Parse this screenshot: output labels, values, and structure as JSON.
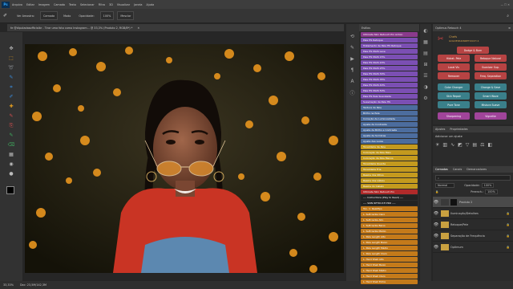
{
  "menubar": {
    "logo": "Ps",
    "items": [
      "Arquivo",
      "Editar",
      "Imagem",
      "Camada",
      "Texto",
      "Selecionar",
      "Filtro",
      "3D",
      "Visualizar",
      "Janela",
      "Ajuda"
    ]
  },
  "options_bar": {
    "items": [
      "Ver Amostra:",
      "Camada",
      "Modo",
      "Opacidade:",
      "100%",
      "Mesclar"
    ]
  },
  "document": {
    "tab_title": "fe @diputadasofficialbr - Tirar uma foto como Instagram... @ 33,3% (Produto 2, RGB/8*) *",
    "zoom": "33,33%",
    "status_info": "Doc: 23,5M/142,3M"
  },
  "toolbar": {
    "tools": [
      "move-tool",
      "marquee-tool",
      "lasso-tool",
      "quick-select-tool",
      "crop-tool",
      "eyedropper-tool",
      "spot-heal-tool",
      "brush-tool",
      "clone-stamp-tool",
      "history-brush-tool",
      "eraser-tool",
      "gradient-tool",
      "blur-tool",
      "dodge-tool",
      "pen-tool",
      "type-tool",
      "path-select-tool",
      "shape-tool",
      "hand-tool",
      "zoom-tool"
    ],
    "glyphs": [
      "✥",
      "⬚",
      "➰",
      "✎",
      "⌗",
      "✐",
      "✚",
      "✎",
      "⎘",
      "✎",
      "⌫",
      "▦",
      "◉",
      "●",
      "✒",
      "T",
      "↖",
      "▭",
      "✋",
      "🔍"
    ]
  },
  "styles_panel": {
    "title": "Estilos",
    "items": [
      {
        "label": "Ultimate Skin Retouch Pro Action",
        "color": "#8a3a8c"
      },
      {
        "label": "Pele HS Retoque",
        "color": "#7b4fb3"
      },
      {
        "label": "Tratamento de Pele HS Retoque",
        "color": "#7b4fb3"
      },
      {
        "label": "Pele HS MAIS Leve",
        "color": "#7b4fb3"
      },
      {
        "label": "Pele HS MAIS 15%",
        "color": "#7b4fb3"
      },
      {
        "label": "Pele HS MAIS 20%",
        "color": "#7b4fb3"
      },
      {
        "label": "Pele HS MAIS 25%",
        "color": "#7b4fb3"
      },
      {
        "label": "Pele HS MAIS 30%",
        "color": "#7b4fb3"
      },
      {
        "label": "Pele HS MAIS 35%",
        "color": "#7b4fb3"
      },
      {
        "label": "Pele HS MAIS 40%",
        "color": "#7b4fb3"
      },
      {
        "label": "Pele HS MAIS 50%",
        "color": "#7b4fb3"
      },
      {
        "label": "Pele HS Pele Suavizada",
        "color": "#7b4fb3"
      },
      {
        "label": "Suavização da Pele HS",
        "color": "#7b4fb3"
      },
      {
        "label": "Textura da Pele",
        "color": "#4c6d9e"
      },
      {
        "label": "Brilho na Pele",
        "color": "#4c6d9e"
      },
      {
        "label": "Correção de Luminosidade",
        "color": "#4c6d9e"
      },
      {
        "label": "Ajuste de Contraste",
        "color": "#4c6d9e"
      },
      {
        "label": "Ajuste de Brilho e Contraste",
        "color": "#4c6d9e"
      },
      {
        "label": "Ajuste de Sombras",
        "color": "#4c6d9e"
      },
      {
        "label": "Ajuste das Luzes",
        "color": "#4c6d9e"
      },
      {
        "label": "Tonalidade da Pele",
        "color": "#c49a1e"
      },
      {
        "label": "Coloração da Pele Mais",
        "color": "#c49a1e"
      },
      {
        "label": "Coloração da Pele Menos",
        "color": "#c49a1e"
      },
      {
        "label": "Tonalidade Quente",
        "color": "#c49a1e"
      },
      {
        "label": "Tonalidade Fria",
        "color": "#c49a1e"
      },
      {
        "label": "Realce dos Olhos",
        "color": "#c49a1e"
      },
      {
        "label": "Realce dos Lábios",
        "color": "#c49a1e"
      },
      {
        "label": "Realce do Cabelo",
        "color": "#c49a1e"
      },
      {
        "label": "Ultimate Skin Retouch Pro",
        "color": "#b02a2a"
      },
      {
        "label": "---- Instructions (Play to Read) ----",
        "color": "#222222"
      },
      {
        "label": "---- SKIN RETOUCH PRO ----",
        "color": "#222222"
      },
      {
        "label": "Ton. 1: Realifipo",
        "color": "#c47a1a"
      },
      {
        "label": "L. Suficiente Claro",
        "color": "#c47a1a"
      },
      {
        "label": "L. Suficiente Alto",
        "color": "#c47a1a"
      },
      {
        "label": "L. Suficiente Baixo",
        "color": "#c47a1a"
      },
      {
        "label": "L. Suficiente Médio",
        "color": "#c47a1a"
      },
      {
        "label": "L. Pele Length Alto",
        "color": "#c47a1a"
      },
      {
        "label": "L. Pele Length Baixo",
        "color": "#c47a1a"
      },
      {
        "label": "L. Pele Length Médio",
        "color": "#c47a1a"
      },
      {
        "label": "L. Pele Length Claro",
        "color": "#c47a1a"
      },
      {
        "label": "L. Hard Shell Alto",
        "color": "#c47a1a"
      },
      {
        "label": "L. Hard Shell Baixo",
        "color": "#c47a1a"
      },
      {
        "label": "L. Hard Shell Médio",
        "color": "#c47a1a"
      },
      {
        "label": "L. Hard Shell Claro",
        "color": "#c47a1a"
      },
      {
        "label": "L. Hard Shell Extra",
        "color": "#c47a1a"
      }
    ]
  },
  "retouch_panel": {
    "title": "Optimus Retouch 4",
    "brand_line1": "Chefs",
    "brand_line2": "GOLDENSKINRETOUCH 4",
    "buttons": [
      {
        "label": "Dodge & Burn",
        "color": "#b64343"
      },
      {
        "label": "Hidrat. Pele",
        "color": "#b64343"
      },
      {
        "label": "Retoque Natural",
        "color": "#b64343"
      },
      {
        "label": "Local Vis",
        "color": "#b64343"
      },
      {
        "label": "Suavizar Sup.",
        "color": "#b64343"
      },
      {
        "label": "Remover",
        "color": "#b64343"
      },
      {
        "label": "Freq. Separation",
        "color": "#b64343"
      },
      {
        "label": "Color Changer",
        "color": "#3a7f8a"
      },
      {
        "label": "Change & Save",
        "color": "#3a7f8a"
      },
      {
        "label": "Skin Repair",
        "color": "#3a7f8a"
      },
      {
        "label": "Smart Wave",
        "color": "#3a7f8a"
      },
      {
        "label": "Pure Tone",
        "color": "#3a7f8a"
      },
      {
        "label": "Mistura Suave",
        "color": "#3a7f8a"
      },
      {
        "label": "Sharpening",
        "color": "#a0449a"
      },
      {
        "label": "Vignette",
        "color": "#a0449a"
      }
    ]
  },
  "swatches_panel": {
    "tabs": [
      "Ajustes",
      "Propriedades"
    ],
    "hint": "Adicionar um ajuste"
  },
  "layers_panel": {
    "tabs": [
      "Camadas",
      "Canais",
      "Demarcadores"
    ],
    "mode": "Normal",
    "opacity_label": "Opacidade:",
    "opacity": "100%",
    "fill_label": "Preench.:",
    "fill": "100%",
    "layers": [
      {
        "name": "Produto 2",
        "color": "#c8a040",
        "locked": false
      },
      {
        "name": "Iluminação/Detalhes",
        "color": "#c8a040",
        "locked": true
      },
      {
        "name": "Retoque/Pele",
        "color": "#c8a040",
        "locked": true
      },
      {
        "name": "Separação de Frequência",
        "color": "#c8a040",
        "locked": true
      },
      {
        "name": "Optimum",
        "color": "#c8a040",
        "locked": true
      }
    ]
  },
  "colors": {
    "foreground": "#000000",
    "background": "#ffffff"
  }
}
